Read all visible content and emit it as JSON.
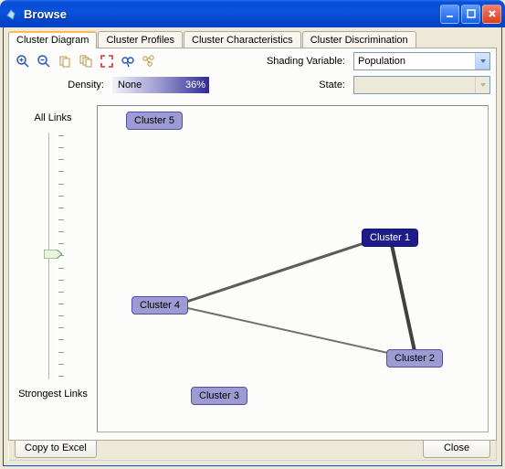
{
  "window": {
    "title": "Browse"
  },
  "tabs": [
    {
      "label": "Cluster Diagram",
      "active": true
    },
    {
      "label": "Cluster Profiles",
      "active": false
    },
    {
      "label": "Cluster Characteristics",
      "active": false
    },
    {
      "label": "Cluster Discrimination",
      "active": false
    }
  ],
  "controls": {
    "shading_label": "Shading Variable:",
    "shading_value": "Population",
    "density_label": "Density:",
    "density_name": "None",
    "density_pct": "36%",
    "state_label": "State:",
    "state_value": ""
  },
  "slider": {
    "top": "All Links",
    "bottom": "Strongest Links"
  },
  "nodes": {
    "c1": "Cluster 1",
    "c2": "Cluster 2",
    "c3": "Cluster 3",
    "c4": "Cluster 4",
    "c5": "Cluster 5"
  },
  "buttons": {
    "copy": "Copy to Excel",
    "close": "Close"
  }
}
